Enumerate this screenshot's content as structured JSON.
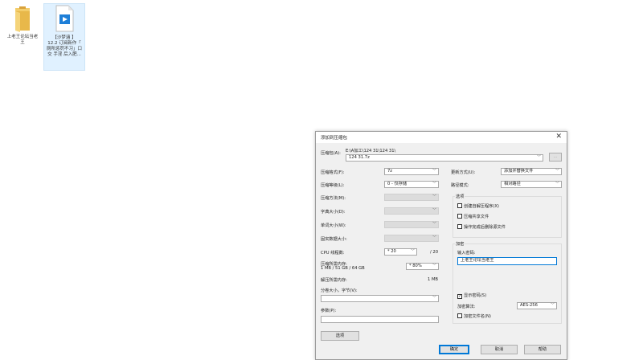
{
  "desktop": {
    "icons": [
      {
        "name": "folder",
        "label_lines": [
          "上老王论坛当老",
          "王"
        ]
      },
      {
        "name": "video-file",
        "label_lines": [
          "【沙梦涵 】",
          "12.2 订阅新作「",
          "厕所惩罚不习」口",
          "交 手淫 后入肥..."
        ]
      }
    ]
  },
  "dialog": {
    "title": "添加到压缩包",
    "close_glyph": "✕",
    "archive": {
      "label": "压缩包(A):",
      "path": "E:\\A加工\\124 31\\124 31\\",
      "value": "124 31.7z",
      "browse_label": "..."
    },
    "left": {
      "format_label": "压缩格式(F):",
      "format_value": "7z",
      "level_label": "压缩等级(L):",
      "level_value": "0 - 仅存储",
      "method_label": "压缩方法(M):",
      "dict_label": "字典大小(D):",
      "word_label": "单词大小(W):",
      "solid_label": "固实数据大小:",
      "threads_label": "CPU 线程数:",
      "threads_value": "* 20",
      "threads_max": "/ 20",
      "mem_label": "压缩所需内存:",
      "mem_detail": "1 MB / 51 GB / 64 GB",
      "mem_value": "* 80%",
      "decomp_label": "解压所需内存:",
      "decomp_value": "1 MB",
      "split_label": "分卷大小，字节(V):",
      "params_label": "参数(P):",
      "options_button": "选项"
    },
    "right": {
      "update_label": "更新方式(U):",
      "update_value": "添加并替换文件",
      "path_label": "路径模式:",
      "path_value": "相对路径",
      "options_group": "选项",
      "opt_sfx": "创建自解压程序(X)",
      "opt_shared": "压缩共享文件",
      "opt_delete": "操作完成后删除源文件",
      "encrypt_group": "加密",
      "password_label": "输入密码:",
      "password_value": "上老王论坛当老王",
      "show_password": "显示密码(S)",
      "algo_label": "加密算法:",
      "algo_value": "AES-256",
      "encrypt_names": "加密文件名(N)"
    },
    "buttons": {
      "ok": "确定",
      "cancel": "取消",
      "help": "帮助"
    }
  }
}
